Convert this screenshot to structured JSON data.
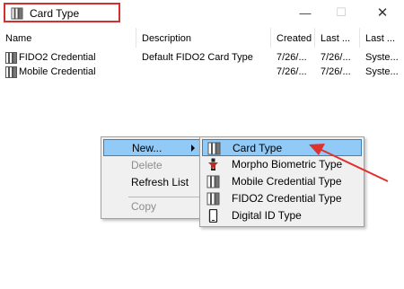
{
  "window": {
    "title": "Card Type",
    "controls": {
      "minimize": "—",
      "maximize": "☐",
      "close": "✕"
    }
  },
  "columns": [
    "Name",
    "Description",
    "Created",
    "Last ...",
    "Last ..."
  ],
  "rows": [
    {
      "name": "FIDO2 Credential",
      "description": "Default FIDO2 Card Type",
      "created": "7/26/...",
      "last_modified": "7/26/...",
      "last_by": "Syste..."
    },
    {
      "name": "Mobile Credential",
      "description": "",
      "created": "7/26/...",
      "last_modified": "7/26/...",
      "last_by": "Syste..."
    }
  ],
  "context_menu": {
    "items": [
      {
        "label": "New...",
        "state": "selected"
      },
      {
        "label": "Delete",
        "state": "disabled"
      },
      {
        "label": "Refresh List",
        "state": "normal"
      },
      {
        "label": "Copy",
        "state": "disabled"
      }
    ]
  },
  "submenu": {
    "items": [
      {
        "label": "Card Type",
        "icon": "card-icon",
        "state": "selected"
      },
      {
        "label": "Morpho Biometric Type",
        "icon": "biometric-person-icon",
        "state": "normal"
      },
      {
        "label": "Mobile Credential Type",
        "icon": "card-icon",
        "state": "normal"
      },
      {
        "label": "FIDO2 Credential Type",
        "icon": "card-icon",
        "state": "normal"
      },
      {
        "label": "Digital ID Type",
        "icon": "phone-icon",
        "state": "normal"
      }
    ]
  },
  "colors": {
    "highlight": "#91c9f7",
    "highlight_border": "#3c7fb1",
    "annotation": "#e0302e",
    "menu_bg": "#f0f0f0"
  }
}
